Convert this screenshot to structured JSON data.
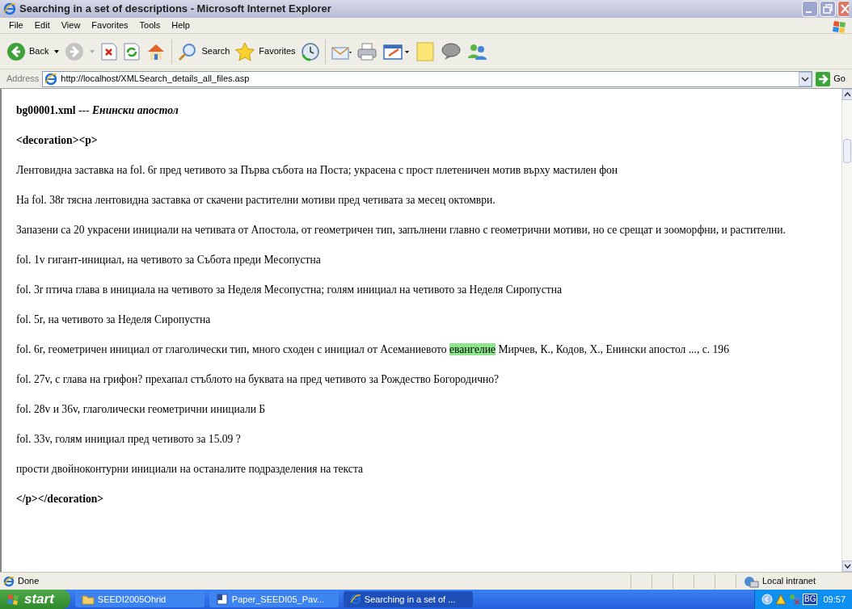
{
  "window": {
    "title": "Searching in a set of descriptions - Microsoft Internet Explorer"
  },
  "menu": [
    "File",
    "Edit",
    "View",
    "Favorites",
    "Tools",
    "Help"
  ],
  "toolbar": {
    "back": "Back",
    "search": "Search",
    "favorites": "Favorites"
  },
  "address": {
    "label": "Address",
    "url": "http://localhost/XMLSearch_details_all_files.asp",
    "go": "Go"
  },
  "document": {
    "heading": {
      "file": "bg00001.xml",
      "separator": "---",
      "title": "Енински апостол"
    },
    "paragraphs": [
      {
        "kind": "tag",
        "segments": [
          {
            "text": "<decoration><p>",
            "highlighted": false
          }
        ]
      },
      {
        "kind": "text",
        "segments": [
          {
            "text": "Лентовидна заставка на fol. 6r пред четивото за Първа събота на Поста; украсена с прост плетеничен мотив върху мастилен фон",
            "highlighted": false
          }
        ]
      },
      {
        "kind": "text",
        "segments": [
          {
            "text": "На fol. 38r тясна лентовидна заставка от скачени растителни мотиви пред четивата за месец октомври.",
            "highlighted": false
          }
        ]
      },
      {
        "kind": "text",
        "segments": [
          {
            "text": "Запазени са 20 украсени инициали на четивата от Апостола, от геометричен тип, запълнени главно с геометрични мотиви, но се срещат и зооморфни, и растителни.",
            "highlighted": false
          }
        ]
      },
      {
        "kind": "text",
        "segments": [
          {
            "text": "fol. 1v гигант-инициал, на четивото за Събота преди Месопустна",
            "highlighted": false
          }
        ]
      },
      {
        "kind": "text",
        "segments": [
          {
            "text": "fol. 3r птича глава в инициала на четивото за Неделя Месопустна; голям инициал на четивото за Неделя Сиропустна",
            "highlighted": false
          }
        ]
      },
      {
        "kind": "text",
        "segments": [
          {
            "text": "fol. 5r, на четивото за Неделя Сиропустна",
            "highlighted": false
          }
        ]
      },
      {
        "kind": "text",
        "segments": [
          {
            "text": "fol. 6r, геометричен инициал от глаголически тип, много сходен с инициал от Асеманиевото ",
            "highlighted": false
          },
          {
            "text": "евангелие",
            "highlighted": true
          },
          {
            "text": " Мирчев, К., Кодов, Х., Енински апостол ..., с. 196",
            "highlighted": false
          }
        ]
      },
      {
        "kind": "text",
        "segments": [
          {
            "text": "fol. 27v, с глава на грифон? прехапал стъблото на буквата на пред четивото за Рождество Богородично?",
            "highlighted": false
          }
        ]
      },
      {
        "kind": "text",
        "segments": [
          {
            "text": "fol. 28v и 36v, глаголически геометрични инициали Б",
            "highlighted": false
          }
        ]
      },
      {
        "kind": "text",
        "segments": [
          {
            "text": "fol. 33v, голям инициал пред четивото за 15.09 ?",
            "highlighted": false
          }
        ]
      },
      {
        "kind": "text",
        "segments": [
          {
            "text": "прости двойноконтурни инициали на останалите подразделения на текста",
            "highlighted": false
          }
        ]
      },
      {
        "kind": "tag",
        "segments": [
          {
            "text": "</p></decoration>",
            "highlighted": false
          }
        ]
      }
    ]
  },
  "status_bar": {
    "status": "Done",
    "zone": "Local intranet"
  },
  "taskbar": {
    "start": "start",
    "tasks": [
      {
        "kind": "folder",
        "label": "SEEDI2005Ohrid",
        "selected": false
      },
      {
        "kind": "word",
        "label": "Paper_SEEDI05_Pav...",
        "selected": false
      },
      {
        "kind": "browser",
        "label": "Searching in a set of ...",
        "selected": true
      }
    ],
    "language": "BG",
    "time": "09:57"
  }
}
